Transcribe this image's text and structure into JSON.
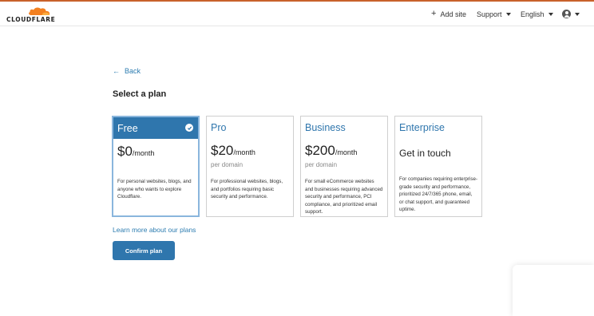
{
  "brand": {
    "logo_text": "CLOUDFLARE",
    "accent_color": "#f38020",
    "primary_color": "#2f76ad"
  },
  "header": {
    "add_site": "Add site",
    "support": "Support",
    "language": "English"
  },
  "back_label": "Back",
  "page_title": "Select a plan",
  "plans": [
    {
      "name": "Free",
      "price": "$0",
      "period": "/month",
      "sub": "",
      "description": "For personal websites, blogs, and anyone who wants to explore Cloudflare.",
      "selected": true
    },
    {
      "name": "Pro",
      "price": "$20",
      "period": "/month",
      "sub": "per domain",
      "description": "For professional websites, blogs, and portfolios requiring basic security and performance.",
      "selected": false
    },
    {
      "name": "Business",
      "price": "$200",
      "period": "/month",
      "sub": "per domain",
      "description": "For small eCommerce websites and businesses requiring advanced security and performance, PCI compliance, and prioritized email support.",
      "selected": false
    },
    {
      "name": "Enterprise",
      "contact": "Get in touch",
      "description": "For companies requiring enterprise-grade security and performance, prioritized 24/7/365 phone, email, or chat support, and guaranteed uptime.",
      "selected": false
    }
  ],
  "learn_more": "Learn more about our plans",
  "confirm_button": "Confirm plan"
}
